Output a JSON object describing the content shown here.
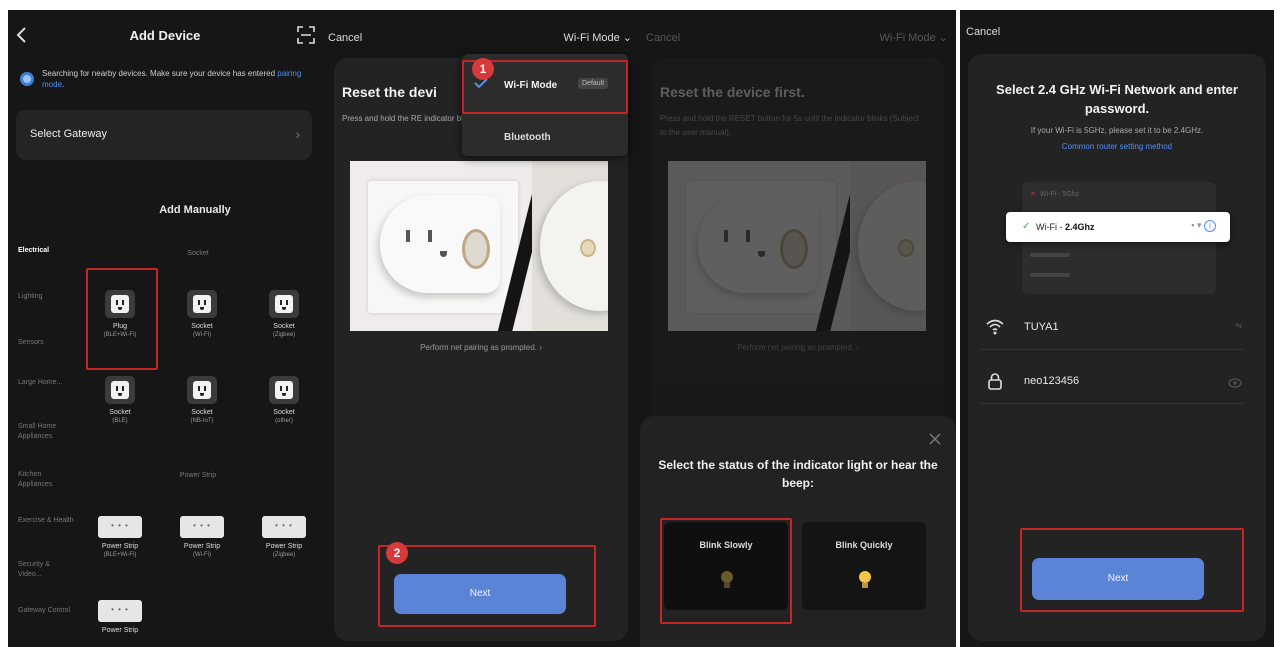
{
  "panel1": {
    "title": "Add Device",
    "search_text": "Searching for nearby devices. Make sure your device has entered ",
    "search_link": "pairing mode",
    "gateway_label": "Select Gateway",
    "gateway_chev": "›",
    "add_manually": "Add Manually",
    "categories": [
      "Electrical",
      "Lighting",
      "Sensors",
      "Large Home...",
      "Small Home Appliances",
      "Kitchen Appliances",
      "Exercise & Health",
      "Security & Video...",
      "Gateway Control"
    ],
    "section_socket": "Socket",
    "section_strip": "Power Strip",
    "sockets": [
      {
        "name": "Plug",
        "sub": "(BLE+Wi-Fi)"
      },
      {
        "name": "Socket",
        "sub": "(Wi-Fi)"
      },
      {
        "name": "Socket",
        "sub": "(Zigbee)"
      },
      {
        "name": "Socket",
        "sub": "(BLE)"
      },
      {
        "name": "Socket",
        "sub": "(NB-IoT)"
      },
      {
        "name": "Socket",
        "sub": "(other)"
      }
    ],
    "strips": [
      {
        "name": "Power Strip",
        "sub": "(BLE+Wi-Fi)"
      },
      {
        "name": "Power Strip",
        "sub": "(Wi-Fi)"
      },
      {
        "name": "Power Strip",
        "sub": "(Zigbee)"
      },
      {
        "name": "Power Strip",
        "sub": ""
      }
    ]
  },
  "panel2": {
    "cancel": "Cancel",
    "mode": "Wi-Fi Mode ⌄",
    "reset_title": "Reset the devi",
    "reset_desc": "Press and hold the RE indicator blinks (Subje",
    "perform": "Perform net pairing as prompted. ›",
    "next": "Next",
    "dropdown": {
      "wifi": "Wi-Fi Mode",
      "default": "Default",
      "bluetooth": "Bluetooth"
    },
    "badge1": "1",
    "badge2": "2"
  },
  "panel3": {
    "cancel": "Cancel",
    "mode": "Wi-Fi Mode ⌄",
    "reset_title": "Reset the device first.",
    "reset_desc": "Press and hold the RESET button for 5s until the indicator blinks (Subject to the user manual).",
    "perform": "Perform net pairing as prompted. ›",
    "sheet_title": "Select the status of the indicator light or hear the beep:",
    "blink_slowly": "Blink Slowly",
    "blink_quickly": "Blink Quickly"
  },
  "panel4": {
    "cancel": "Cancel",
    "title": "Select 2.4 GHz Wi-Fi Network and enter password.",
    "hint": "If your Wi-Fi is 5GHz, please set it to be 2.4GHz.",
    "link": "Common router setting method",
    "net_5g": "Wi-Fi - 5Ghz",
    "net_24_prefix": "Wi-Fi - ",
    "net_24_band": "2.4Ghz",
    "ssid": "TUYA1",
    "ssid_end": "⇆",
    "password": "neo123456",
    "next": "Next"
  }
}
